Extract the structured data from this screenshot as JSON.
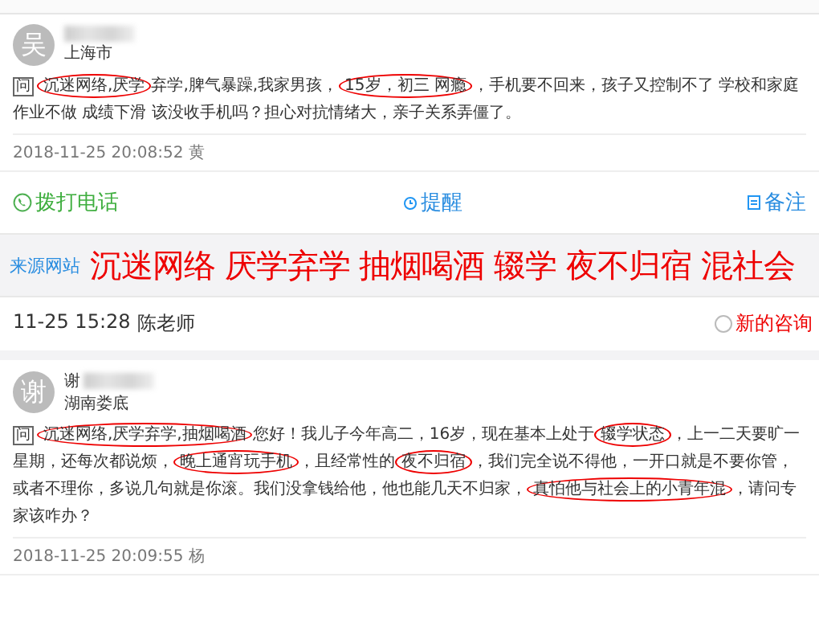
{
  "posts": [
    {
      "avatar": "吴",
      "location": "上海市",
      "badge": "问",
      "segments": [
        {
          "text": "沉迷网络,厌学",
          "circled": true
        },
        {
          "text": "弃学,脾气暴躁,我家男孩，",
          "circled": false
        },
        {
          "text": "15岁，初三 网瘾",
          "circled": true
        },
        {
          "text": "，手机要不回来，孩子又控制不了 学校和家庭作业不做 成绩下滑 该没收手机吗？担心对抗情绪大，亲子关系弄僵了。",
          "circled": false
        }
      ],
      "date": "2018-11-25 20:08:52 黄"
    },
    {
      "avatar": "谢",
      "name": "谢",
      "location": "湖南娄底",
      "badge": "问",
      "segments": [
        {
          "text": "沉迷网络,厌学弃学,抽烟喝酒",
          "circled": true
        },
        {
          "text": "您好！我儿子今年高二，16岁，现在基本上处于",
          "circled": false
        },
        {
          "text": "辍学状态",
          "circled": true
        },
        {
          "text": "，上一二天要旷一星期，还每次都说烦，",
          "circled": false
        },
        {
          "text": "晚上通宵玩手机",
          "circled": true
        },
        {
          "text": "，且经常性的",
          "circled": false
        },
        {
          "text": "夜不归宿",
          "circled": true
        },
        {
          "text": "，我们完全说不得他，一开口就是不要你管，或者不理你，多说几句就是你滚。我们没拿钱给他，他也能几天不归家，",
          "circled": false
        },
        {
          "text": "真怕他与社会上的小青年混",
          "circled": true
        },
        {
          "text": "，请问专家该咋办？",
          "circled": false
        }
      ],
      "date": "2018-11-25 20:09:55 杨"
    }
  ],
  "actions": [
    {
      "kind": "call",
      "label": "拨打电话"
    },
    {
      "kind": "remind",
      "label": "提醒"
    },
    {
      "kind": "note",
      "label": "备注"
    }
  ],
  "source": {
    "label": "来源网站"
  },
  "overlay_caption": "沉迷网络 厌学弃学 抽烟喝酒 辍学 夜不归宿 混社会",
  "consult": {
    "time": "11-25 15:28",
    "teacher": "陈老师",
    "option": {
      "label": "新的咨询",
      "selected": false
    }
  }
}
